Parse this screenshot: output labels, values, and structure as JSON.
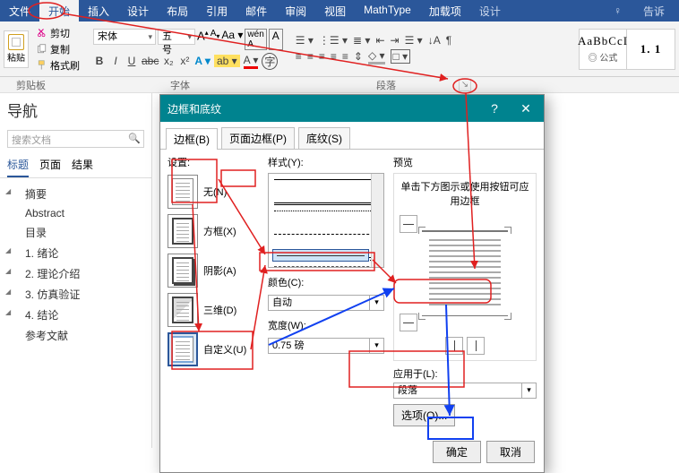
{
  "ribbon": {
    "tabs": [
      "文件",
      "开始",
      "插入",
      "设计",
      "布局",
      "引用",
      "邮件",
      "审阅",
      "视图",
      "MathType",
      "加载项"
    ],
    "tab_design2": "设计",
    "tell_me": "告诉",
    "tell_me_icon": "♀",
    "active_index": 1,
    "clipboard": {
      "paste": "粘贴",
      "cut": "剪切",
      "copy": "复制",
      "format_painter": "格式刷",
      "label": "剪贴板"
    },
    "font": {
      "name": "宋体",
      "size": "五号",
      "row1": [
        "A",
        "A",
        "Aa",
        "",
        "wén",
        "A"
      ],
      "row2": [
        "B",
        "I",
        "U",
        "abc",
        "x₂",
        "x²",
        "A",
        "",
        "A",
        "A"
      ],
      "label": "字体"
    },
    "paragraph": {
      "label": "段落"
    },
    "styles": [
      {
        "text": "AaBbCcI",
        "label": "◎ 公式"
      },
      {
        "text": "1. 1",
        "label": ""
      }
    ]
  },
  "nav": {
    "title": "导航",
    "search_placeholder": "搜索文档",
    "tabs": [
      "标题",
      "页面",
      "结果"
    ],
    "active_tab": 0,
    "items": [
      {
        "t": "摘要",
        "ch": true
      },
      {
        "t": "Abstract"
      },
      {
        "t": "目录"
      },
      {
        "t": "1. 绪论",
        "ch": true
      },
      {
        "t": "2. 理论介绍",
        "ch": true
      },
      {
        "t": "3. 仿真验证",
        "ch": true
      },
      {
        "t": "4. 结论",
        "ch": true
      },
      {
        "t": "参考文献"
      }
    ]
  },
  "dialog": {
    "title": "边框和底纹",
    "tabs": [
      "边框(B)",
      "页面边框(P)",
      "底纹(S)"
    ],
    "active_tab": 0,
    "setting_label": "设置:",
    "settings": [
      {
        "name": "none",
        "label": "无(N)"
      },
      {
        "name": "box",
        "label": "方框(X)"
      },
      {
        "name": "shadow",
        "label": "阴影(A)"
      },
      {
        "name": "three_d",
        "label": "三维(D)"
      },
      {
        "name": "custom",
        "label": "自定义(U)",
        "selected": true
      }
    ],
    "style_label": "样式(Y):",
    "color_label": "颜色(C):",
    "color_value": "自动",
    "width_label": "宽度(W):",
    "width_value": "0.75 磅",
    "preview_label": "预览",
    "preview_hint": "单击下方图示或使用按钮可应用边框",
    "apply_to_label": "应用于(L):",
    "apply_to_value": "段落",
    "options_btn": "选项(O)...",
    "ok": "确定",
    "cancel": "取消"
  }
}
